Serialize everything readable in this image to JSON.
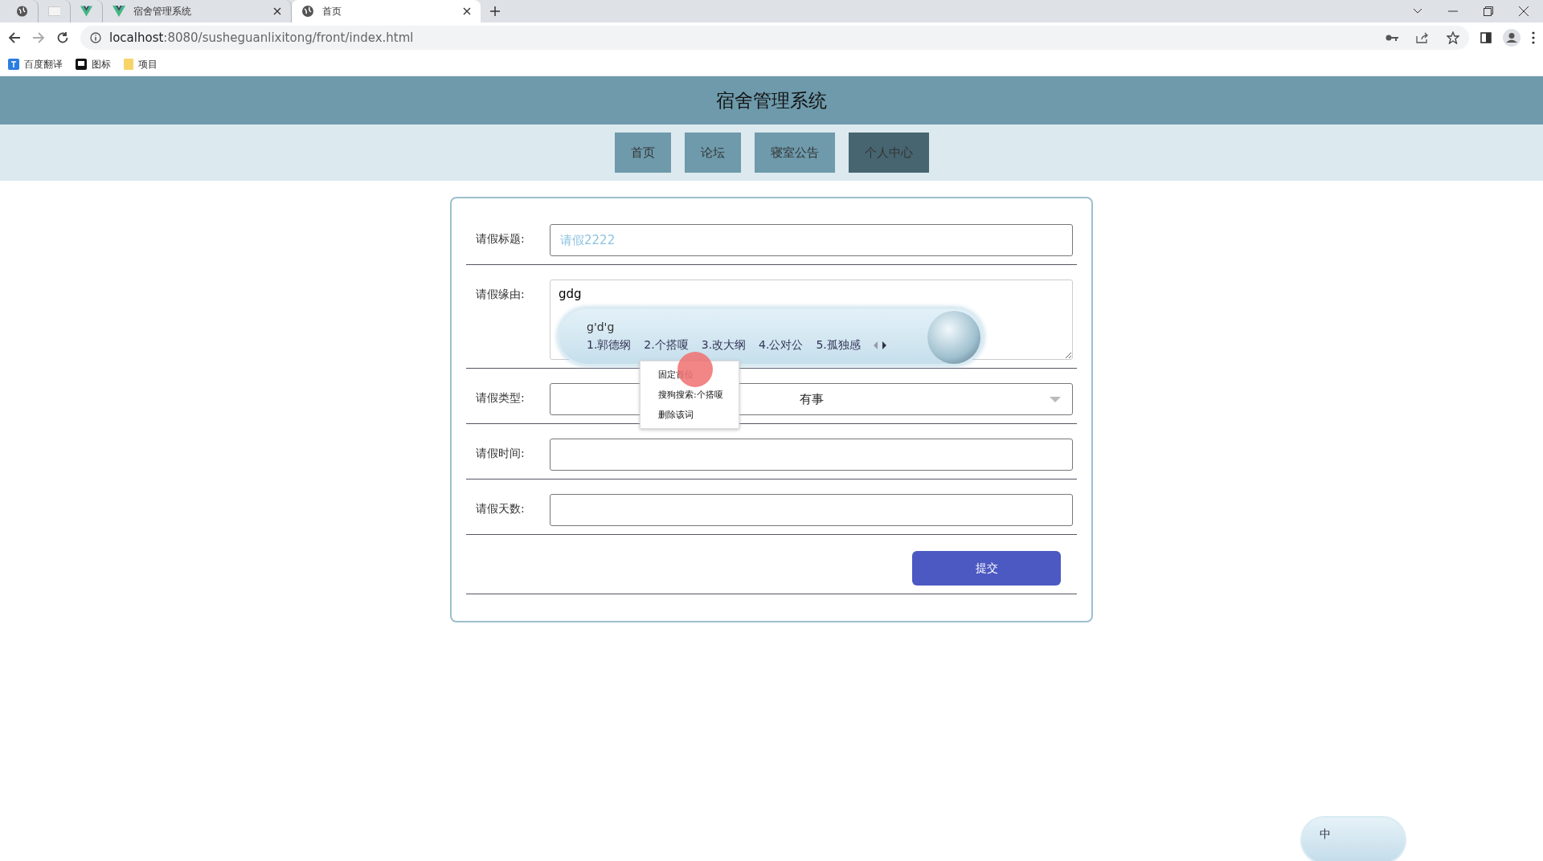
{
  "browser": {
    "tabs": [
      {
        "kind": "globe",
        "selected": false
      },
      {
        "kind": "blank",
        "selected": false
      },
      {
        "kind": "vue",
        "selected": false
      },
      {
        "kind": "vue",
        "title": "宿舍管理系统",
        "selected": false
      },
      {
        "kind": "globe",
        "title": "首页",
        "selected": true
      }
    ],
    "address": {
      "host": "localhost",
      "rest": ":8080/susheguanlixitong/front/index.html"
    },
    "bookmarks": [
      {
        "kind": "translate",
        "label": "百度翻译"
      },
      {
        "kind": "flag",
        "label": "图标"
      },
      {
        "kind": "folder",
        "label": "项目"
      }
    ]
  },
  "site": {
    "title": "宿舍管理系统",
    "nav": [
      {
        "label": "首页",
        "selected": false
      },
      {
        "label": "论坛",
        "selected": false
      },
      {
        "label": "寝室公告",
        "selected": false
      },
      {
        "label": "个人中心",
        "selected": true
      }
    ]
  },
  "form": {
    "fields": [
      {
        "kind": "input",
        "label": "请假标题:",
        "value": "请假2222"
      },
      {
        "kind": "textarea",
        "label": "请假缘由:",
        "value": "gdg"
      },
      {
        "kind": "select",
        "label": "请假类型:",
        "value": "有事"
      },
      {
        "kind": "input",
        "label": "请假时间:"
      },
      {
        "kind": "input",
        "label": "请假天数:"
      }
    ],
    "submit": "提交"
  },
  "ime": {
    "composition": "g'd'g",
    "candidates": [
      "1.郭德纲",
      "2.个搭嗄",
      "3.改大纲",
      "4.公对公",
      "5.孤独感"
    ],
    "menu": [
      "固定首位",
      "搜狗搜索:个搭嗄",
      "删除该词"
    ],
    "status": "中"
  }
}
